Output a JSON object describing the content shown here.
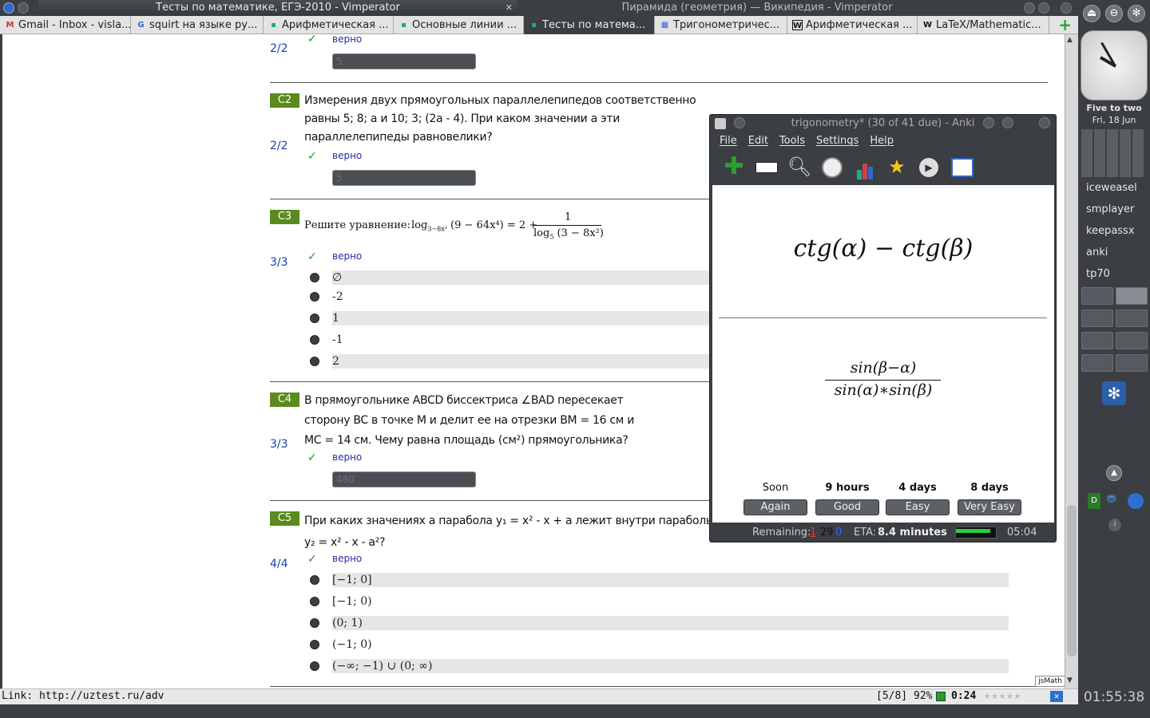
{
  "titlebar": {
    "left_title": "Тесты по математике, ЕГЭ-2010 - Vimperator",
    "right_title": "Пирамида (геометрия) — Википедия - Vimperator",
    "close": "✕"
  },
  "tabs": [
    {
      "label": "Gmail - Inbox - visla...",
      "icon": "M",
      "color": "#c33"
    },
    {
      "label": "squirt на языке ру...",
      "icon": "G",
      "color": "#3366cc"
    },
    {
      "label": "Арифметическая ...",
      "icon": "▪",
      "color": "#2a7"
    },
    {
      "label": "Основные линии ...",
      "icon": "▪",
      "color": "#2a7"
    },
    {
      "label": "Тесты по матема...",
      "icon": "▪",
      "color": "#2a7",
      "active": true
    },
    {
      "label": "Тригонометричес...",
      "icon": "▦",
      "color": "#36c"
    },
    {
      "label": "Арифметическая ...",
      "icon": "W",
      "color": "#111"
    },
    {
      "label": "LaTeX/Mathematic...",
      "icon": "W",
      "color": "#111"
    }
  ],
  "tab_add": "+",
  "questions": {
    "c1": {
      "score": "2/2",
      "status": "верно",
      "answer": "5"
    },
    "c2": {
      "label": "C2",
      "text1": "Измерения двух прямоугольных параллелепипедов соответственно",
      "text2": "равны 5; 8; а и 10; 3; (2а - 4). При каком значении а эти",
      "text3": "параллелепипеды равновелики?",
      "score": "2/2",
      "status": "верно",
      "answer": "5"
    },
    "c3": {
      "label": "C3",
      "prefix": "Решите уравнение:",
      "score": "3/3",
      "status": "верно",
      "options": [
        "∅",
        "-2",
        "1",
        "-1",
        "2"
      ]
    },
    "c4": {
      "label": "C4",
      "text1": "В прямоугольнике  ABCD  биссектриса  ∠BAD  пересекает",
      "text2": "сторону  BC  в точке  M  и делит ее на отрезки   BM = 16 см  и",
      "text3": "MC = 14 см. Чему равна площадь (см²) прямоугольника?",
      "score": "3/3",
      "status": "верно",
      "answer": "480"
    },
    "c5": {
      "label": "C5",
      "text1": "При каких значениях a парабола y₁ = x² - x + a лежит внутри параболы",
      "text2": "y₂ = x² - x - a²?",
      "score": "4/4",
      "status": "верно",
      "options": [
        "[−1; 0]",
        "[−1; 0)",
        "(0; 1)",
        "(−1; 0)",
        "(−∞; −1) ∪ (0; ∞)"
      ]
    }
  },
  "jsmath_badge": "jsMath",
  "statusbar": {
    "link": "Link: http://uztest.ru/adv",
    "position": "[5/8]",
    "zoom": "92%",
    "time": "0:24"
  },
  "anki": {
    "title": "trigonometry* (30 of 41 due) - Anki",
    "menu": [
      "File",
      "Edit",
      "Tools",
      "Settings",
      "Help"
    ],
    "question": "ctg(α) − ctg(β)",
    "answer_num": "sin(β−α)",
    "answer_den": "sin(α)∗sin(β)",
    "ease_labels": [
      "Soon",
      "9 hours",
      "4 days",
      "8 days"
    ],
    "ease_buttons": [
      "Again",
      "Good",
      "Easy",
      "Very Easy"
    ],
    "remaining_label": "Remaining:",
    "remaining_new": "1",
    "remaining_rev": "29",
    "remaining_learn": "0",
    "eta_label": "ETA:",
    "eta_value": "8.4 minutes",
    "progress": 0.85,
    "timer": "05:04"
  },
  "panel": {
    "clock_caption": "Five to two",
    "date": "Fri, 18 Jun",
    "apps": [
      "iceweasel",
      "smplayer",
      "keepassx",
      "anki",
      "tp70"
    ],
    "clock_time": "01:55:38"
  }
}
